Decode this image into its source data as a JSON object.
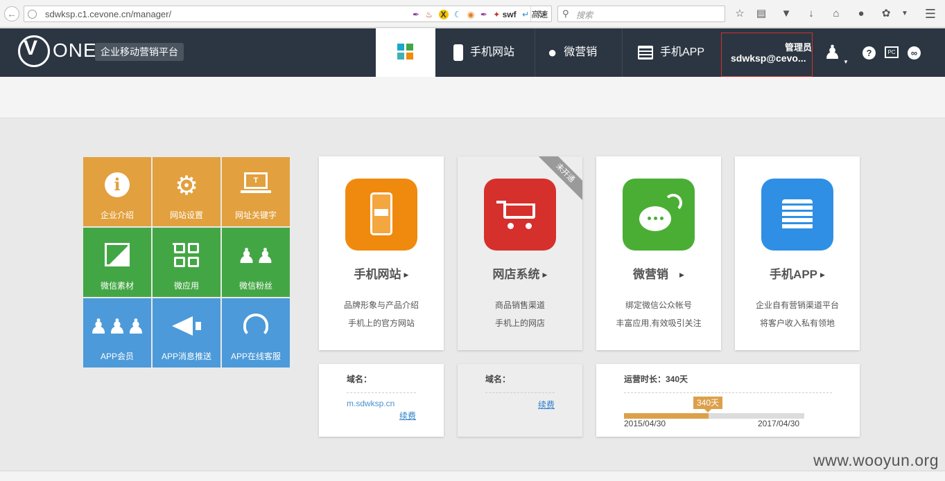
{
  "browser": {
    "url": "sdwksp.c1.cevone.cn/manager/",
    "extensions": {
      "swf_label": "swf",
      "speed_label": "高速"
    },
    "search_placeholder": "搜索"
  },
  "header": {
    "logo_text": "ONE",
    "platform_badge": "企业移动营销平台",
    "nav": [
      {
        "label": "手机网站",
        "icon": "phone-icon"
      },
      {
        "label": "微营销",
        "icon": "wechat-icon"
      },
      {
        "label": "手机APP",
        "icon": "app-list-icon"
      }
    ],
    "admin": {
      "role": "管理员",
      "email": "sdwksp@cevo..."
    }
  },
  "tiles": [
    {
      "label": "企业介绍",
      "icon": "info-icon",
      "color": "#e2a03e"
    },
    {
      "label": "网站设置",
      "icon": "gear-icon",
      "color": "#e2a03e"
    },
    {
      "label": "网址关键字",
      "icon": "laptop-icon",
      "color": "#e2a03e"
    },
    {
      "label": "微信素材",
      "icon": "image-icon",
      "color": "#43a645"
    },
    {
      "label": "微应用",
      "icon": "apps-grid-icon",
      "color": "#43a645"
    },
    {
      "label": "微信粉丝",
      "icon": "users-icon",
      "color": "#43a645"
    },
    {
      "label": "APP会员",
      "icon": "members-icon",
      "color": "#4c9ad9"
    },
    {
      "label": "APP消息推送",
      "icon": "megaphone-icon",
      "color": "#4c9ad9"
    },
    {
      "label": "APP在线客服",
      "icon": "headset-icon",
      "color": "#4c9ad9"
    }
  ],
  "products": [
    {
      "title": "手机网站",
      "desc1": "品牌形象与产品介绍",
      "desc2": "手机上的官方网站",
      "color": "#f08a0f",
      "icon": "mobile-site-icon",
      "enabled": true
    },
    {
      "title": "网店系统",
      "desc1": "商品销售渠道",
      "desc2": "手机上的网店",
      "color": "#d6302d",
      "icon": "cart-icon",
      "enabled": false,
      "ribbon": "未开通"
    },
    {
      "title": "微营销",
      "desc1": "绑定微信公众帐号",
      "desc2": "丰富应用,有效吸引关注",
      "color": "#4aae35",
      "icon": "wechat-icon",
      "enabled": true
    },
    {
      "title": "手机APP",
      "desc1": "企业自有营销渠道平台",
      "desc2": "将客户收入私有领地",
      "color": "#2f8fe4",
      "icon": "app-list-icon",
      "enabled": true
    }
  ],
  "info": {
    "site": {
      "label": "域名：",
      "domain": "m.sdwksp.cn",
      "renew": "续费"
    },
    "shop": {
      "label": "域名：",
      "renew": "续费"
    },
    "runtime": {
      "label": "运营时长：340天",
      "tip": "340天",
      "progress": 0.47,
      "start": "2015/04/30",
      "end": "2017/04/30"
    }
  },
  "watermark": "www.wooyun.org"
}
